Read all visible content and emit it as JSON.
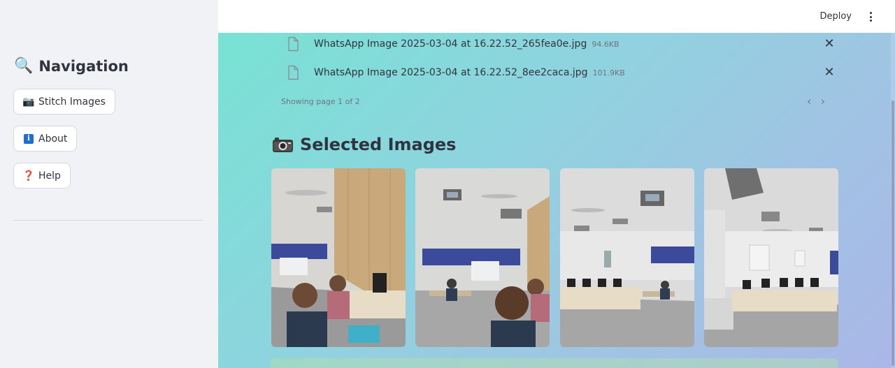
{
  "header": {
    "deploy_label": "Deploy"
  },
  "sidebar": {
    "title": "Navigation",
    "title_emoji": "🔍",
    "buttons": [
      {
        "emoji": "📷",
        "label": "Stitch Images"
      },
      {
        "emoji": "i",
        "label": "About"
      },
      {
        "emoji": "❓",
        "label": "Help"
      }
    ]
  },
  "uploader": {
    "files": [
      {
        "name": "WhatsApp Image 2025-03-04 at 16.22.52_265fea0e.jpg",
        "size": "94.6KB"
      },
      {
        "name": "WhatsApp Image 2025-03-04 at 16.22.52_8ee2caca.jpg",
        "size": "101.9KB"
      }
    ],
    "page_info": "Showing page 1 of 2",
    "prev_icon": "‹",
    "next_icon": "›"
  },
  "selected": {
    "title": "Selected Images",
    "images": [
      {
        "alt": "image-1"
      },
      {
        "alt": "image-2"
      },
      {
        "alt": "image-3"
      },
      {
        "alt": "image-4"
      }
    ]
  },
  "colors": {
    "sidebar_bg": "#f0f2f6",
    "gradient_start": "#78e2d4",
    "gradient_end": "#aab6e8",
    "text": "#31333f"
  }
}
